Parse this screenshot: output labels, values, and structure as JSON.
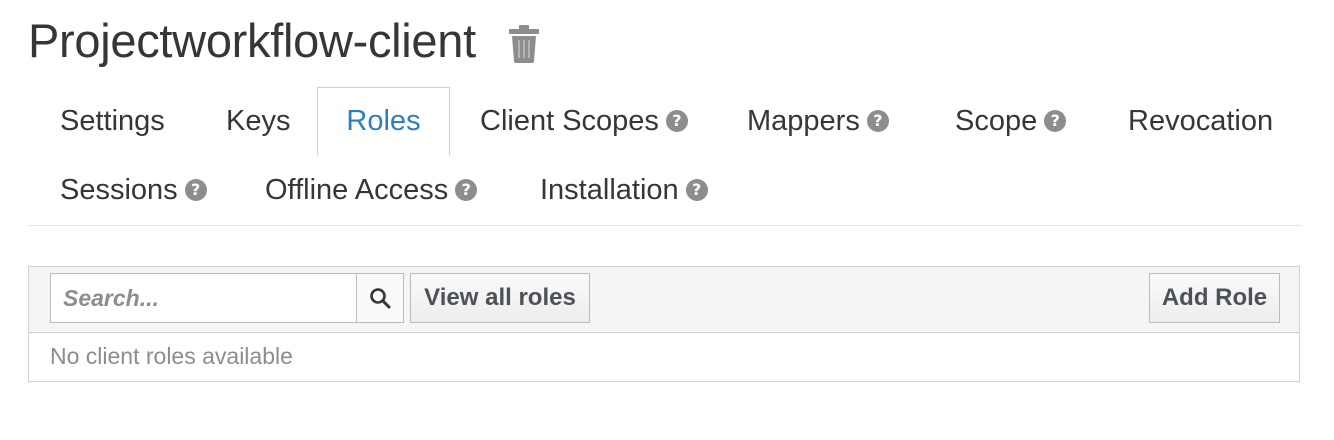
{
  "header": {
    "title": "Projectworkflow-client",
    "delete_icon": "trash-icon"
  },
  "tabs": [
    {
      "label": "Settings",
      "help": false,
      "active": false
    },
    {
      "label": "Keys",
      "help": false,
      "active": false
    },
    {
      "label": "Roles",
      "help": false,
      "active": true
    },
    {
      "label": "Client Scopes",
      "help": true,
      "active": false
    },
    {
      "label": "Mappers",
      "help": true,
      "active": false
    },
    {
      "label": "Scope",
      "help": true,
      "active": false
    },
    {
      "label": "Revocation",
      "help": false,
      "active": false
    },
    {
      "label": "Sessions",
      "help": true,
      "active": false
    },
    {
      "label": "Offline Access",
      "help": true,
      "active": false
    },
    {
      "label": "Installation",
      "help": true,
      "active": false
    }
  ],
  "help_glyph": "?",
  "toolbar": {
    "search_placeholder": "Search...",
    "search_icon": "search-icon",
    "view_all_label": "View all roles",
    "add_role_label": "Add Role"
  },
  "table": {
    "empty_message": "No client roles available"
  },
  "colors": {
    "active_tab": "#2c7fbf",
    "text": "#363636",
    "muted": "#8b8d8f"
  }
}
